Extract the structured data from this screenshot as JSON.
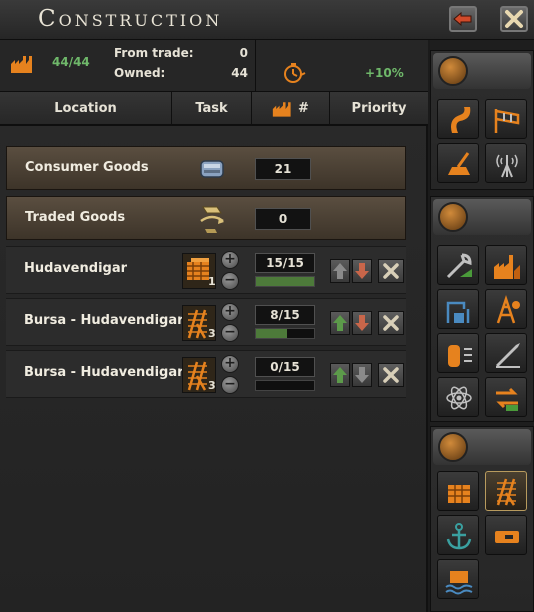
{
  "window": {
    "title": "Construction"
  },
  "summary": {
    "factory_count": "44/44",
    "from_trade_label": "From trade:",
    "from_trade_value": "0",
    "owned_label": "Owned:",
    "owned_value": "44",
    "speed_bonus": "+10%"
  },
  "columns": {
    "location": "Location",
    "task": "Task",
    "count": "#",
    "priority": "Priority"
  },
  "goods": [
    {
      "name": "Consumer Goods",
      "value": "21",
      "icon": "consumer-goods-icon"
    },
    {
      "name": "Traded Goods",
      "value": "0",
      "icon": "traded-goods-icon"
    }
  ],
  "projects": [
    {
      "location": "Hudavendigar",
      "building_icon": "military-factory-icon",
      "count": "1",
      "progress_text": "15/15",
      "progress": 1.0
    },
    {
      "location": "Bursa - Hudavendigar",
      "building_icon": "railway-icon",
      "count": "3",
      "progress_text": "8/15",
      "progress": 0.53
    },
    {
      "location": "Bursa - Hudavendigar",
      "building_icon": "railway-icon",
      "count": "3",
      "progress_text": "0/15",
      "progress": 0.0
    }
  ],
  "colors": {
    "accent_green": "#6fb86a",
    "factory_orange": "#e6821e",
    "goods_row": "#4a4034"
  }
}
